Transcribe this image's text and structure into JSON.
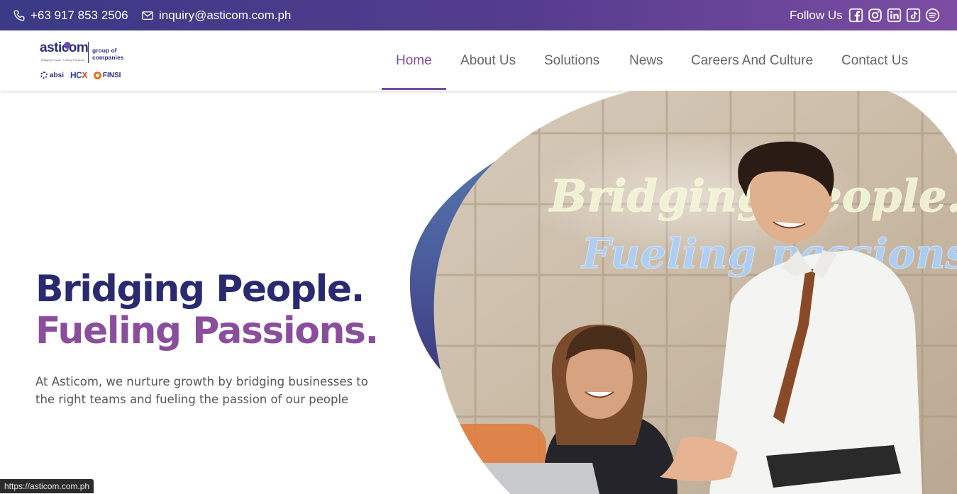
{
  "topbar": {
    "phone": "+63 917 853 2506",
    "email": "inquiry@asticom.com.ph",
    "follow_label": "Follow Us",
    "social": [
      "facebook-icon",
      "instagram-icon",
      "linkedin-icon",
      "tiktok-icon",
      "spotify-icon"
    ],
    "gradient": [
      "#3a3a86",
      "#7c4da3"
    ]
  },
  "logo": {
    "name": "asticom",
    "tagline": "Bridging People. Fueling Passions.",
    "group_line1": "group of",
    "group_line2": "companies",
    "sub_brands": [
      "absi",
      "HC",
      "X",
      "FINSI"
    ]
  },
  "nav": {
    "items": [
      {
        "label": "Home",
        "active": true
      },
      {
        "label": "About Us"
      },
      {
        "label": "Solutions"
      },
      {
        "label": "News"
      },
      {
        "label": "Careers And Culture"
      },
      {
        "label": "Contact Us"
      }
    ],
    "active_color": "#7d4b9b"
  },
  "hero": {
    "title_line1": "Bridging People.",
    "title_line2": "Fueling Passions.",
    "subtitle": "At Asticom, we nurture growth by bridging businesses to the right teams and fueling the passion of our people",
    "image_alt": "Two employees smiling at a laptop in front of a neon sign",
    "neon_line1": "Bridging people.",
    "neon_line2": "Fueling passions."
  },
  "status_bar": {
    "url": "https://asticom.com.ph"
  }
}
